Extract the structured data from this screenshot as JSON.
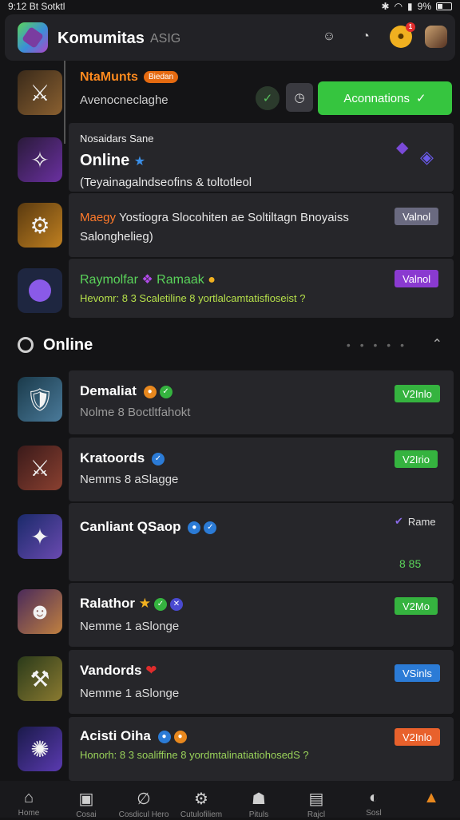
{
  "status": {
    "time": "9:12",
    "carrier": "Bt Sotktl",
    "battery": "9%"
  },
  "header": {
    "title": "Komumitas",
    "subtitle": "ASIG",
    "notif_count": "1"
  },
  "featured": {
    "title": "NtaMunts",
    "badge": "Biedan",
    "subtitle": "Avenocneclaghe",
    "action_label": "Aconnations"
  },
  "items": [
    {
      "label": "Nosaidars Sane",
      "title": "Online",
      "desc": "(Teyainagalndseofins & toltotleol"
    },
    {
      "title": "Maegy",
      "desc_line1": "Yostiogra Slocohiten ae Soltiltagn Bnoyaiss",
      "desc_line2": "Salonghelieg)",
      "pill": "Valnol"
    },
    {
      "name_a": "Raymolfar",
      "name_b": "Ramaak",
      "desc": "Hevomr: 8 3 Scaletiline 8 yortlalcamtatisfioseist ?",
      "pill": "Valnol"
    }
  ],
  "section": {
    "title": "Online"
  },
  "users": [
    {
      "name": "Demaliat",
      "status": "Nolme 8 Boctltfahokt",
      "pill": "V2Inlo",
      "pill_color": "#35b33f"
    },
    {
      "name": "Kratoords",
      "status": "Nemms 8 aSlagge",
      "pill": "V2Irio",
      "pill_color": "#35b33f"
    },
    {
      "name": "Canliant QSaop",
      "status": "",
      "pill": "Rame",
      "pill_color": "transparent",
      "extra": "8 85"
    },
    {
      "name": "Ralathor",
      "status": "Nemme 1 aSlonge",
      "pill": "V2Mo",
      "pill_color": "#35b33f"
    },
    {
      "name": "Vandords",
      "status": "Nemme 1 aSlonge",
      "pill": "VSinls",
      "pill_color": "#2b7bd6"
    },
    {
      "name": "Acisti Oiha",
      "status": "Honorh: 8 3 soaliffine 8 yordmtalinatiatiohosedS ?",
      "pill": "V2Inlo",
      "pill_color": "#e8612c"
    }
  ],
  "nav": [
    {
      "label": "Home",
      "icon": "home-icon"
    },
    {
      "label": "Cosai",
      "icon": "tv-icon"
    },
    {
      "label": "Cosdicul Hero",
      "icon": "link-icon"
    },
    {
      "label": "Cutulofiliem",
      "icon": "gear-icon"
    },
    {
      "label": "Pituls",
      "icon": "people-icon"
    },
    {
      "label": "Rajcl",
      "icon": "message-icon"
    },
    {
      "label": "Sosl",
      "icon": "compass-icon"
    },
    {
      "label": "",
      "icon": "triangle-icon"
    }
  ]
}
